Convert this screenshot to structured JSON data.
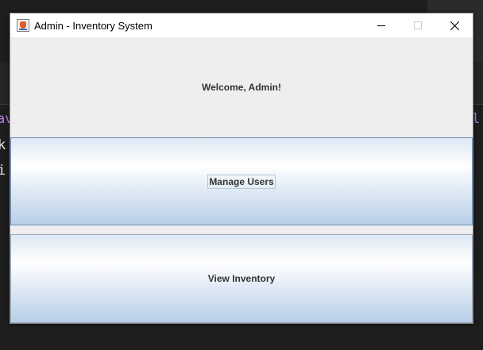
{
  "window": {
    "title": "Admin - Inventory System",
    "icon": "java-cup-icon",
    "controls": {
      "minimize": "minimize-icon",
      "maximize": "maximize-icon",
      "close": "close-icon"
    }
  },
  "welcome": {
    "text": "Welcome, Admin!"
  },
  "buttons": {
    "manage_users": "Manage Users",
    "view_inventory": "View Inventory"
  },
  "background_ide": {
    "line1": "av",
    "line2": "k",
    "line3": "i",
    "right_fragment": "l"
  }
}
